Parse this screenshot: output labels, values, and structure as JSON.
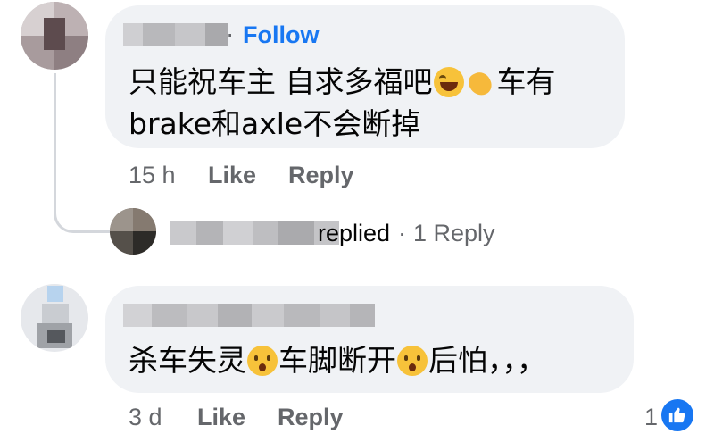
{
  "comment1": {
    "follow_separator": "·",
    "follow_label": "Follow",
    "text_part1": "只能祝车主 自求多福吧",
    "text_part2": "车有",
    "text_line2": "brake和axle不会断掉",
    "emoji1": "laughing-crying-emoji",
    "emoji2": "clapping-hands-emoji",
    "time": "15 h",
    "like_label": "Like",
    "reply_label": "Reply"
  },
  "reply_summary": {
    "replied_label": "replied",
    "separator": "·",
    "count_label": "1 Reply"
  },
  "comment2": {
    "text_part1": "杀车失灵",
    "text_part2": "车脚断开",
    "text_part3": "后怕，，，",
    "emoji": "hushed-face-emoji",
    "time": "3 d",
    "like_label": "Like",
    "reply_label": "Reply",
    "reaction_count": "1"
  },
  "colors": {
    "bubble": "#f0f2f5",
    "link_blue": "#1877f2",
    "meta_gray": "#65676b",
    "text": "#050505"
  }
}
